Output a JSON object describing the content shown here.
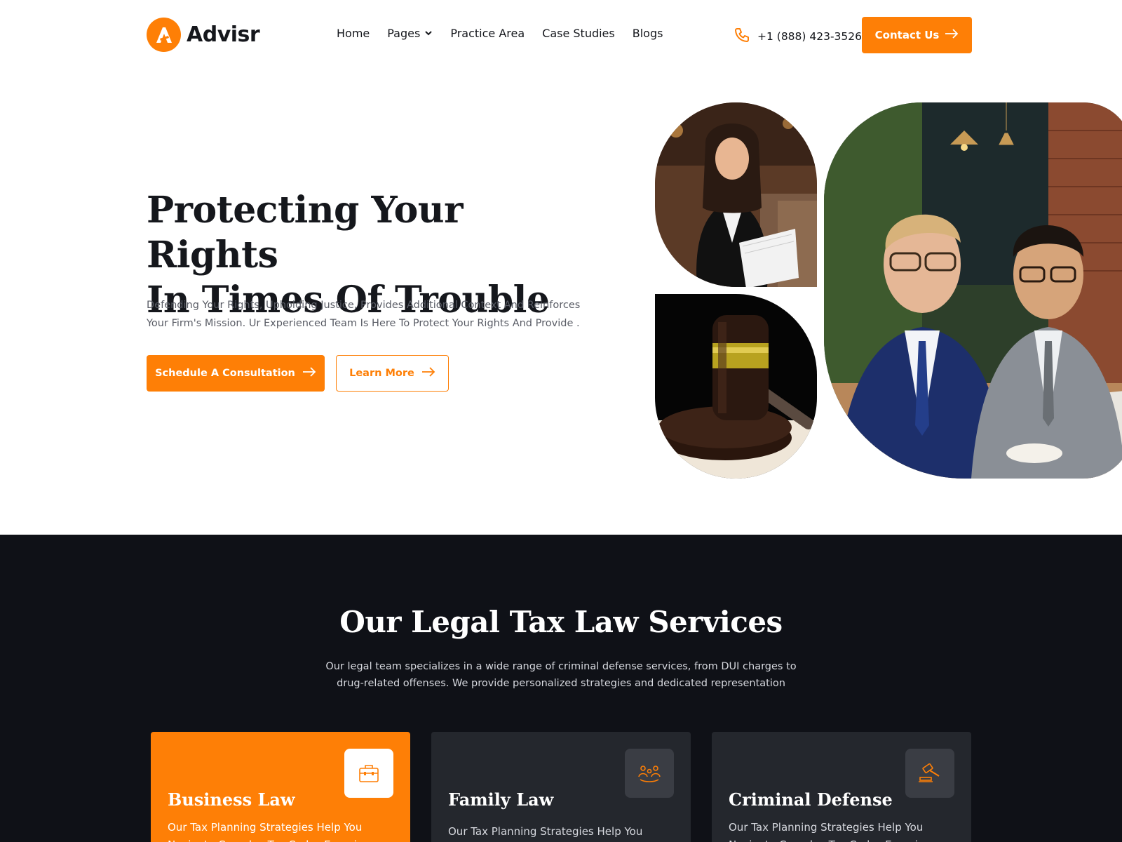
{
  "brand": {
    "name": "Advisr",
    "color": "#fe7f06"
  },
  "nav": {
    "items": [
      {
        "label": "Home"
      },
      {
        "label": "Pages",
        "has_dropdown": true
      },
      {
        "label": "Practice Area"
      },
      {
        "label": "Case Studies"
      },
      {
        "label": "Blogs"
      }
    ]
  },
  "header": {
    "phone": "+1 (888) 423-3526",
    "contact_label": "Contact Us"
  },
  "hero": {
    "title_line1": "Protecting Your Rights",
    "title_line2": "In Times Of Trouble",
    "text": "Defending Your Rights, Upholding Justice, Provides Additional Context And Reinforces Your Firm's Mission. Ur Experienced Team Is Here To Protect Your Rights And Provide .",
    "primary_label": "Schedule A Consultation",
    "secondary_label": "Learn More"
  },
  "services": {
    "title": "Our Legal Tax Law Services",
    "subtitle": "Our legal team specializes in a wide range of criminal defense services, from DUI charges to drug-related offenses. We provide personalized strategies and dedicated representation",
    "cards": [
      {
        "title": "Business Law",
        "text": "Our Tax Planning Strategies Help You Navigate Complex Tax Codes Ensuring",
        "icon": "briefcase-icon"
      },
      {
        "title": "Family Law",
        "text": "Our Tax Planning Strategies Help You",
        "icon": "family-icon"
      },
      {
        "title": "Criminal Defense",
        "text": "Our Tax Planning Strategies Help You Navigate Complex Tax Codes Ensuring",
        "icon": "gavel-icon"
      }
    ]
  }
}
